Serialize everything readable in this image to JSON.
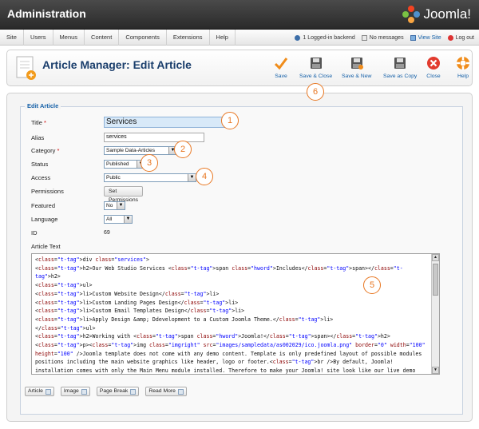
{
  "header": {
    "title": "Administration",
    "logo_text": "Joomla!"
  },
  "menu": {
    "items": [
      "Site",
      "Users",
      "Menus",
      "Content",
      "Components",
      "Extensions",
      "Help"
    ]
  },
  "status": {
    "logged_in": "1 Logged-in backend",
    "messages": "No messages",
    "view_site": "View Site",
    "logout": "Log out"
  },
  "toolbar": {
    "page_title": "Article Manager: Edit Article",
    "buttons": [
      {
        "label": "Save",
        "icon": "check-icon"
      },
      {
        "label": "Save & Close",
        "icon": "disk-icon"
      },
      {
        "label": "Save & New",
        "icon": "disk-plus-icon"
      },
      {
        "label": "Save as Copy",
        "icon": "disk-copy-icon"
      },
      {
        "label": "Close",
        "icon": "close-icon"
      },
      {
        "label": "Help",
        "icon": "help-icon"
      }
    ]
  },
  "form": {
    "legend": "Edit Article",
    "title_label": "Title",
    "title_value": "Services",
    "alias_label": "Alias",
    "alias_value": "services",
    "category_label": "Category",
    "category_value": "Sample Data-Articles",
    "status_label": "Status",
    "status_value": "Published",
    "access_label": "Access",
    "access_value": "Public",
    "permissions_label": "Permissions",
    "permissions_button": "Set Permissions",
    "featured_label": "Featured",
    "featured_value": "No",
    "language_label": "Language",
    "language_value": "All",
    "id_label": "ID",
    "id_value": "69",
    "article_text_label": "Article Text",
    "required_mark": "*"
  },
  "editor": {
    "lines": [
      "<div class=\"services\">",
      "<h2>Our Web Studio Services <span class=\"hword\">Includes</span></h2>",
      "<ul>",
      "<li>Custom Website Design</li>",
      "<li>Custom Landing Pages Design</li>",
      "<li>Custom Email Templates Design</li>",
      "<li>Apply Design &amp; Ddevelopment to a Custom Joomla Theme.</li>",
      "</ul>",
      "<h2>Working with <span class=\"hword\">Joomla!</span></h2>",
      "<p><img class=\"imgright\" src=\"images/sampledata/as002029/ico.joomla.png\" border=\"0\" width=\"100\" height=\"100\" />Joomla template does not come with any demo content. Template is only predefined layout of possible modules positions including the main website graphics like header, logo or footer.<br />By default, Joomla! installation comes with only the Main Menu module installed. Therefore to make your Joomla! site look like our live demo please, you have to install all necessary modules through the administration section of your site. You may also need to add all"
    ],
    "buttons": [
      "Article",
      "Image",
      "Page Break",
      "Read More"
    ]
  },
  "callouts": [
    "1",
    "2",
    "3",
    "4",
    "5",
    "6"
  ],
  "colors": {
    "accent": "#e87722",
    "link": "#1560a8",
    "title": "#1a3e6c"
  }
}
